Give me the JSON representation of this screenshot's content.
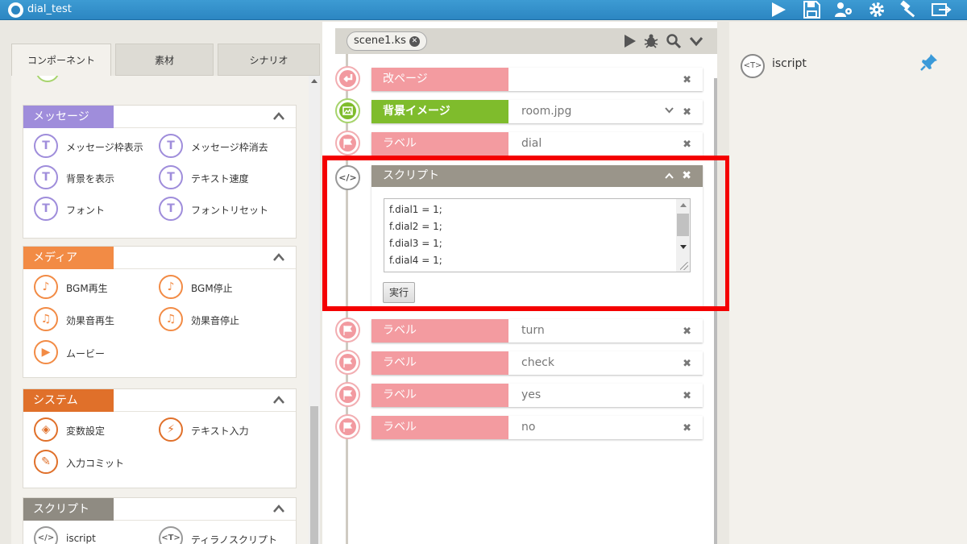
{
  "app": {
    "title": "dial_test"
  },
  "left_tabs": [
    "コンポーネント",
    "素材",
    "シナリオ"
  ],
  "categories": {
    "message": {
      "title": "メッセージ",
      "color": "#9f8ddb",
      "items": [
        "メッセージ枠表示",
        "メッセージ枠消去",
        "背景を表示",
        "テキスト速度",
        "フォント",
        "フォントリセット"
      ]
    },
    "media": {
      "title": "メディア",
      "color": "#f28b45",
      "items": [
        "BGM再生",
        "BGM停止",
        "効果音再生",
        "効果音停止",
        "ムービー"
      ]
    },
    "system": {
      "title": "システム",
      "color": "#e0702a",
      "items": [
        "変数設定",
        "テキスト入力",
        "入力コミット"
      ]
    },
    "script": {
      "title": "スクリプト",
      "color": "#8f8b82",
      "items": [
        "iscript",
        "ティラノスクリプト"
      ]
    }
  },
  "scene": {
    "tab_label": "scene1.ks"
  },
  "rows": {
    "r1": {
      "title": "改ページ",
      "value": ""
    },
    "r2": {
      "title": "背景イメージ",
      "value": "room.jpg"
    },
    "r3": {
      "title": "ラベル",
      "value": "dial"
    },
    "r4": {
      "title": "ラベル",
      "value": "turn"
    },
    "r5": {
      "title": "ラベル",
      "value": "check"
    },
    "r6": {
      "title": "ラベル",
      "value": "yes"
    },
    "r7": {
      "title": "ラベル",
      "value": "no"
    }
  },
  "script_block": {
    "title": "スクリプト",
    "code_lines": [
      "f.dial1 = 1;",
      "f.dial2 = 1;",
      "f.dial3 = 1;",
      "f.dial4 = 1;"
    ],
    "run_label": "実行"
  },
  "right_panel": {
    "label": "iscript"
  },
  "icons": {
    "play": "play-icon",
    "save": "save-icon",
    "users": "users-icon",
    "settings": "gear-icon",
    "build": "hammer-icon",
    "export": "export-icon",
    "bug": "bug-icon",
    "search": "search-icon",
    "pin": "pin-icon"
  }
}
